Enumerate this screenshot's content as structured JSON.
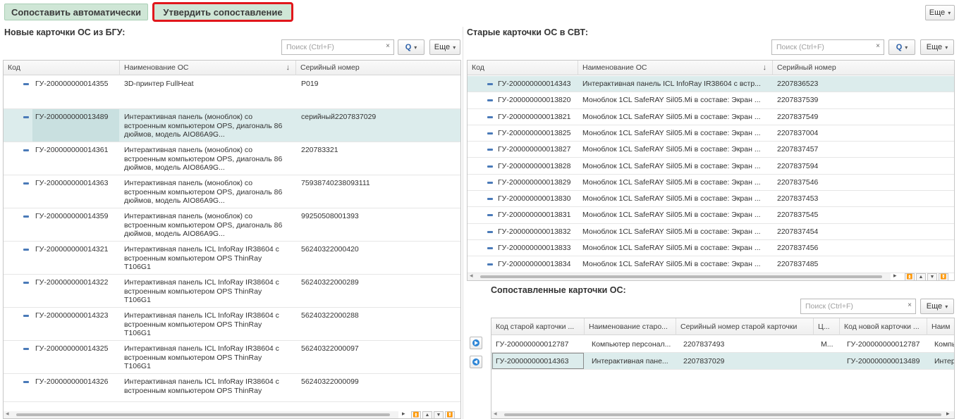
{
  "toolbar": {
    "auto_match_label": "Сопоставить автоматически",
    "confirm_label": "Утвердить сопоставление",
    "more_label": "Еще"
  },
  "left_panel": {
    "title": "Новые карточки ОС из БГУ:",
    "search_placeholder": "Поиск (Ctrl+F)",
    "clear_glyph": "×",
    "search_glyph": "Q",
    "more_label": "Еще",
    "columns": [
      "Код",
      "Наименование ОС",
      "Серийный номер"
    ],
    "rows": [
      {
        "code": "ГУ-200000000014355",
        "name": "3D-принтер FullHeat",
        "serial": "P019"
      },
      {
        "code": "ГУ-200000000013489",
        "name": "Интерактивная панель (моноблок) со встроенным компьютером OPS, диагональ 86 дюймов, модель AIO86A9G...",
        "serial": "серийный2207837029"
      },
      {
        "code": "ГУ-200000000014361",
        "name": "Интерактивная панель (моноблок) со встроенным компьютером OPS, диагональ 86 дюймов, модель AIO86A9G...",
        "serial": "220783321"
      },
      {
        "code": "ГУ-200000000014363",
        "name": "Интерактивная панель (моноблок) со встроенным компьютером OPS, диагональ 86 дюймов, модель AIO86A9G...",
        "serial": "75938740238093111"
      },
      {
        "code": "ГУ-200000000014359",
        "name": "Интерактивная панель (моноблок) со встроенным компьютером OPS, диагональ 86 дюймов, модель AIO86A9G...",
        "serial": "99250508001393"
      },
      {
        "code": "ГУ-200000000014321",
        "name": "Интерактивная панель ICL InfoRay IR38604 с встроенным компьютером OPS ThinRay T106G1",
        "serial": "56240322000420"
      },
      {
        "code": "ГУ-200000000014322",
        "name": "Интерактивная панель ICL InfoRay IR38604 с встроенным компьютером OPS ThinRay T106G1",
        "serial": "56240322000289"
      },
      {
        "code": "ГУ-200000000014323",
        "name": "Интерактивная панель ICL InfoRay IR38604 с встроенным компьютером OPS ThinRay T106G1",
        "serial": "56240322000288"
      },
      {
        "code": "ГУ-200000000014325",
        "name": "Интерактивная панель ICL InfoRay IR38604 с встроенным компьютером OPS ThinRay T106G1",
        "serial": "56240322000097"
      },
      {
        "code": "ГУ-200000000014326",
        "name": "Интерактивная панель ICL InfoRay IR38604 с встроенным компьютером OPS ThinRay",
        "serial": "56240322000099"
      }
    ]
  },
  "right_panel": {
    "title": "Старые карточки ОС в СВТ:",
    "search_placeholder": "Поиск (Ctrl+F)",
    "clear_glyph": "×",
    "search_glyph": "Q",
    "more_label": "Еще",
    "columns": [
      "Код",
      "Наименование ОС",
      "Серийный номер"
    ],
    "rows": [
      {
        "code": "ГУ-200000000014343",
        "name": "Интерактивная панель ICL InfoRay IR38604 с встр...",
        "serial": "2207836523"
      },
      {
        "code": "ГУ-200000000013820",
        "name": "Моноблок 1CL SafeRAY Sil05.Mi в составе: Экран ...",
        "serial": "2207837539"
      },
      {
        "code": "ГУ-200000000013821",
        "name": "Моноблок 1CL SafeRAY Sil05.Mi в составе: Экран ...",
        "serial": "2207837549"
      },
      {
        "code": "ГУ-200000000013825",
        "name": "Моноблок 1CL SafeRAY Sil05.Mi в составе: Экран ...",
        "serial": "2207837004"
      },
      {
        "code": "ГУ-200000000013827",
        "name": "Моноблок 1CL SafeRAY Sil05.Mi в составе: Экран ...",
        "serial": "2207837457"
      },
      {
        "code": "ГУ-200000000013828",
        "name": "Моноблок 1CL SafeRAY Sil05.Mi в составе: Экран ...",
        "serial": "2207837594"
      },
      {
        "code": "ГУ-200000000013829",
        "name": "Моноблок 1CL SafeRAY Sil05.Mi в составе: Экран ...",
        "serial": "2207837546"
      },
      {
        "code": "ГУ-200000000013830",
        "name": "Моноблок 1CL SafeRAY Sil05.Mi в составе: Экран ...",
        "serial": "2207837453"
      },
      {
        "code": "ГУ-200000000013831",
        "name": "Моноблок 1CL SafeRAY Sil05.Mi в составе: Экран ...",
        "serial": "2207837545"
      },
      {
        "code": "ГУ-200000000013832",
        "name": "Моноблок 1CL SafeRAY Sil05.Mi в составе: Экран ...",
        "serial": "2207837454"
      },
      {
        "code": "ГУ-200000000013833",
        "name": "Моноблок 1CL SafeRAY Sil05.Mi в составе: Экран ...",
        "serial": "2207837456"
      },
      {
        "code": "ГУ-200000000013834",
        "name": "Моноблок 1CL SafeRAY Sil05.Mi в составе: Экран ...",
        "serial": "2207837485"
      }
    ]
  },
  "matched_panel": {
    "title": "Сопоставленные карточки ОС:",
    "search_placeholder": "Поиск (Ctrl+F)",
    "clear_glyph": "×",
    "more_label": "Еще",
    "columns": [
      "Код старой карточки ...",
      "Наименование старо...",
      "Серийный номер старой карточки",
      "Ц...",
      "Код новой карточки ...",
      "Наим"
    ],
    "rows": [
      {
        "old_code": "ГУ-200000000012787",
        "old_name": "Компьютер персонал...",
        "old_serial": "2207837493",
        "c": "М...",
        "new_code": "ГУ-200000000012787",
        "new_name": "Компь"
      },
      {
        "old_code": "ГУ-200000000014363",
        "old_name": "Интерактивная пане...",
        "old_serial": "2207837029",
        "c": "",
        "new_code": "ГУ-200000000013489",
        "new_name": "Интер"
      }
    ]
  },
  "nav": {
    "first": "⏫",
    "up": "▲",
    "down": "▼",
    "last": "⏬",
    "scroll_left": "◂",
    "scroll_right": "▸"
  },
  "icons": [
    "chevron-down-icon",
    "search-icon",
    "clear-icon",
    "arrow-right-icon",
    "arrow-left-icon",
    "sort-down-icon"
  ],
  "colors": {
    "accent_green": "#cfe6d6",
    "highlight_red": "#e1171c",
    "selection": "#dcecec",
    "link_blue": "#2f86d6"
  },
  "sort_glyph": "↓",
  "caret_glyph": "▾"
}
